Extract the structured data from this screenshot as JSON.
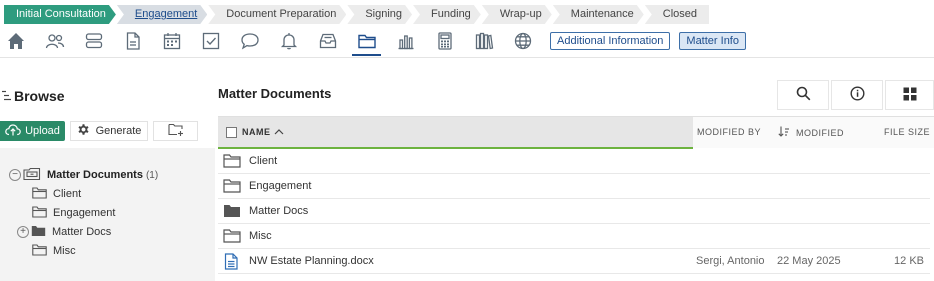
{
  "stages": [
    {
      "label": "Initial Consultation",
      "state": "done"
    },
    {
      "label": "Engagement",
      "state": "current"
    },
    {
      "label": "Document Preparation",
      "state": "todo"
    },
    {
      "label": "Signing",
      "state": "todo"
    },
    {
      "label": "Funding",
      "state": "todo"
    },
    {
      "label": "Wrap-up",
      "state": "todo"
    },
    {
      "label": "Maintenance",
      "state": "todo"
    },
    {
      "label": "Closed",
      "state": "todo"
    }
  ],
  "toolbar": {
    "icons": [
      "home-icon",
      "people-icon",
      "layers-icon",
      "document-icon",
      "calendar-icon",
      "checkbox-icon",
      "chat-icon",
      "bell-icon",
      "inbox-icon",
      "folder-icon",
      "bar-chart-icon",
      "calculator-icon",
      "books-icon",
      "globe-icon"
    ],
    "active_icon": "folder-icon",
    "additional_info": "Additional Information",
    "matter_info": "Matter Info"
  },
  "browse": {
    "title": "Browse",
    "upload": "Upload",
    "generate": "Generate",
    "tree": {
      "root": {
        "name": "Matter Documents",
        "count": "(1)"
      },
      "children": [
        "Client",
        "Engagement",
        "Matter Docs",
        "Misc"
      ]
    }
  },
  "documents": {
    "title": "Matter Documents",
    "columns": {
      "name": "NAME",
      "modified_by": "MODIFIED BY",
      "modified": "MODIFIED",
      "file_size": "FILE SIZE"
    },
    "rows": [
      {
        "type": "folder",
        "name": "Client",
        "modified_by": "",
        "modified": "",
        "size": ""
      },
      {
        "type": "folder",
        "name": "Engagement",
        "modified_by": "",
        "modified": "",
        "size": ""
      },
      {
        "type": "folder-filled",
        "name": "Matter Docs",
        "modified_by": "",
        "modified": "",
        "size": ""
      },
      {
        "type": "folder",
        "name": "Misc",
        "modified_by": "",
        "modified": "",
        "size": ""
      },
      {
        "type": "file",
        "name": "NW Estate Planning.docx",
        "modified_by": "Sergi, Antonio",
        "modified": "22 May 2025",
        "size": "12 KB"
      }
    ]
  },
  "colors": {
    "done_stage": "#2e9c7f",
    "upload_button": "#2a8a67",
    "accent_blue": "#1e4d8c",
    "sort_underline": "#6db33f"
  }
}
